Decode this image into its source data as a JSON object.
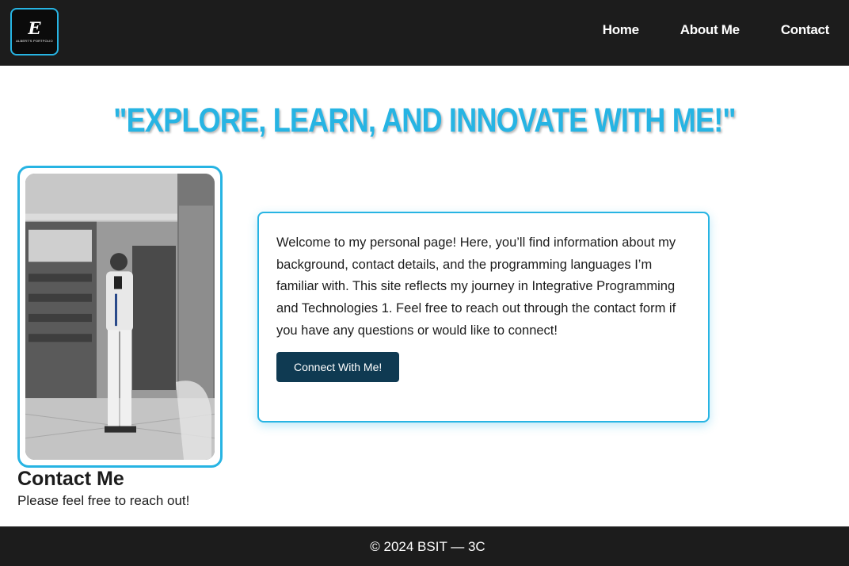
{
  "nav": {
    "logo": {
      "mark": "E",
      "text": "ALBERT'S PORTFOLIO"
    },
    "links": [
      "Home",
      "About Me",
      "Contact"
    ]
  },
  "hero": {
    "title": "\"Explore, Learn, and Innovate with Me!\""
  },
  "welcome": {
    "text": "Welcome to my personal page! Here, you’ll find information about my background, contact details, and the programming languages I’m familiar with. This site reflects my journey in Integrative Programming and Technologies 1. Feel free to reach out through the contact form if you have any questions or would like to connect!",
    "button": "Connect With Me!"
  },
  "contact": {
    "heading": "Contact Me",
    "subtext": "Please feel free to reach out!"
  },
  "footer": {
    "text": "© 2024 BSIT — 3C"
  },
  "colors": {
    "accent": "#27b4e3",
    "nav_bg": "#1c1c1c",
    "button_bg": "#0f3a52"
  }
}
